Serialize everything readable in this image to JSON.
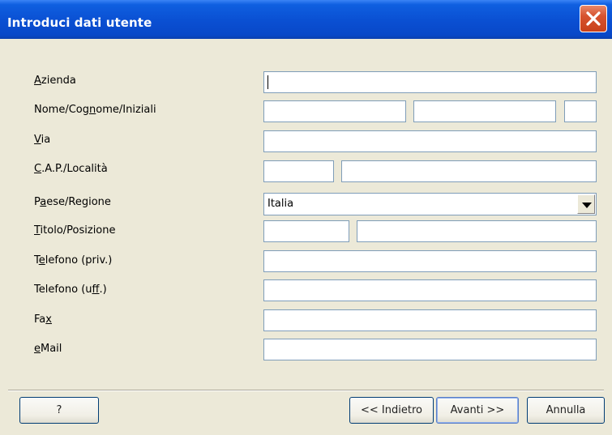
{
  "window": {
    "title": "Introduci dati utente",
    "close_icon": "close-icon"
  },
  "form": {
    "labels": {
      "azienda": "Azienda",
      "nome": "Nome/Cognome/Iniziali",
      "via": "Via",
      "cap": "C.A.P./Località",
      "paese": "Paese/Regione",
      "titolo": "Titolo/Posizione",
      "tel_priv": "Telefono (priv.)",
      "tel_uff": "Telefono (uff.)",
      "fax": "Fax",
      "email": "eMail"
    },
    "values": {
      "azienda": "",
      "nome": "",
      "cognome": "",
      "iniziali": "",
      "via": "",
      "cap": "",
      "localita": "",
      "paese": "Italia",
      "titolo": "",
      "posizione": "",
      "tel_priv": "",
      "tel_uff": "",
      "fax": "",
      "email": ""
    }
  },
  "buttons": {
    "help": "?",
    "back": "<< Indietro",
    "next": "Avanti >>",
    "cancel": "Annulla"
  }
}
